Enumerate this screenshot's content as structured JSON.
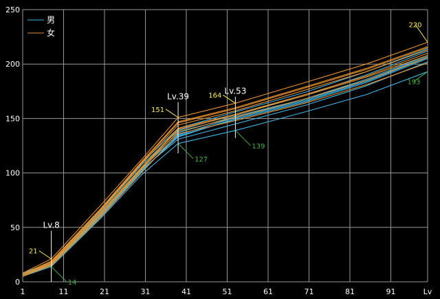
{
  "chart_data": {
    "type": "line",
    "title": "",
    "xlabel": "Lv",
    "ylabel": "",
    "xlim": [
      1,
      100
    ],
    "ylim": [
      0,
      250
    ],
    "x_ticks": [
      1,
      11,
      21,
      31,
      41,
      51,
      61,
      71,
      81,
      91
    ],
    "y_ticks": [
      0,
      50,
      100,
      150,
      200,
      250
    ],
    "grid": true,
    "background": "#000000",
    "legend": {
      "position": "top-left",
      "entries": [
        {
          "label": "男",
          "color": "#3fb6e8"
        },
        {
          "label": "女",
          "color": "#e8922a"
        }
      ]
    },
    "series": [
      {
        "group": "男",
        "color": "#3fb6e8",
        "points": [
          [
            1,
            7
          ],
          [
            8,
            16
          ],
          [
            20,
            62
          ],
          [
            30,
            105
          ],
          [
            39,
            137
          ],
          [
            53,
            152
          ],
          [
            70,
            168
          ],
          [
            85,
            186
          ],
          [
            100,
            208
          ]
        ]
      },
      {
        "group": "男",
        "color": "#3fb6e8",
        "points": [
          [
            1,
            6
          ],
          [
            8,
            15
          ],
          [
            20,
            60
          ],
          [
            30,
            102
          ],
          [
            39,
            133
          ],
          [
            53,
            150
          ],
          [
            70,
            166
          ],
          [
            85,
            184
          ],
          [
            100,
            206
          ]
        ]
      },
      {
        "group": "男",
        "color": "#3fb6e8",
        "points": [
          [
            1,
            5
          ],
          [
            8,
            14
          ],
          [
            20,
            58
          ],
          [
            30,
            98
          ],
          [
            39,
            127
          ],
          [
            53,
            139
          ],
          [
            70,
            156
          ],
          [
            85,
            172
          ],
          [
            100,
            193
          ]
        ]
      },
      {
        "group": "男",
        "color": "#3fb6e8",
        "points": [
          [
            1,
            6
          ],
          [
            8,
            15
          ],
          [
            20,
            61
          ],
          [
            30,
            103
          ],
          [
            39,
            131
          ],
          [
            53,
            145
          ],
          [
            70,
            162
          ],
          [
            85,
            180
          ],
          [
            100,
            202
          ]
        ]
      },
      {
        "group": "男",
        "color": "#3fb6e8",
        "points": [
          [
            1,
            7
          ],
          [
            8,
            17
          ],
          [
            20,
            64
          ],
          [
            30,
            107
          ],
          [
            39,
            139
          ],
          [
            53,
            154
          ],
          [
            70,
            171
          ],
          [
            85,
            190
          ],
          [
            100,
            212
          ]
        ]
      },
      {
        "group": "男",
        "color": "#3fb6e8",
        "points": [
          [
            1,
            8
          ],
          [
            8,
            18
          ],
          [
            20,
            66
          ],
          [
            30,
            109
          ],
          [
            39,
            141
          ],
          [
            53,
            156
          ],
          [
            70,
            174
          ],
          [
            85,
            193
          ],
          [
            100,
            214
          ]
        ]
      },
      {
        "group": "男",
        "color": "#3fb6e8",
        "points": [
          [
            1,
            6
          ],
          [
            8,
            16
          ],
          [
            20,
            63
          ],
          [
            30,
            104
          ],
          [
            39,
            135
          ],
          [
            53,
            151
          ],
          [
            70,
            167
          ],
          [
            85,
            185
          ],
          [
            100,
            207
          ]
        ]
      },
      {
        "group": "男",
        "color": "#3fb6e8",
        "points": [
          [
            1,
            7
          ],
          [
            8,
            15
          ],
          [
            20,
            60
          ],
          [
            30,
            101
          ],
          [
            39,
            134
          ],
          [
            53,
            149
          ],
          [
            70,
            165
          ],
          [
            85,
            183
          ],
          [
            100,
            205
          ]
        ]
      },
      {
        "group": "女",
        "color": "#e8922a",
        "points": [
          [
            1,
            8
          ],
          [
            8,
            21
          ],
          [
            20,
            70
          ],
          [
            30,
            112
          ],
          [
            39,
            151
          ],
          [
            53,
            164
          ],
          [
            70,
            183
          ],
          [
            85,
            200
          ],
          [
            100,
            220
          ]
        ]
      },
      {
        "group": "女",
        "color": "#e8922a",
        "points": [
          [
            1,
            7
          ],
          [
            8,
            19
          ],
          [
            20,
            67
          ],
          [
            30,
            110
          ],
          [
            39,
            147
          ],
          [
            53,
            160
          ],
          [
            70,
            179
          ],
          [
            85,
            196
          ],
          [
            100,
            216
          ]
        ]
      },
      {
        "group": "女",
        "color": "#e8922a",
        "points": [
          [
            1,
            7
          ],
          [
            8,
            18
          ],
          [
            20,
            65
          ],
          [
            30,
            108
          ],
          [
            39,
            144
          ],
          [
            53,
            157
          ],
          [
            70,
            176
          ],
          [
            85,
            193
          ],
          [
            100,
            213
          ]
        ]
      },
      {
        "group": "女",
        "color": "#e8922a",
        "points": [
          [
            1,
            6
          ],
          [
            8,
            17
          ],
          [
            20,
            63
          ],
          [
            30,
            105
          ],
          [
            39,
            141
          ],
          [
            53,
            154
          ],
          [
            70,
            172
          ],
          [
            85,
            189
          ],
          [
            100,
            210
          ]
        ]
      },
      {
        "group": "女",
        "color": "#e8922a",
        "points": [
          [
            1,
            6
          ],
          [
            8,
            16
          ],
          [
            20,
            61
          ],
          [
            30,
            103
          ],
          [
            39,
            138
          ],
          [
            53,
            151
          ],
          [
            70,
            168
          ],
          [
            85,
            185
          ],
          [
            100,
            206
          ]
        ]
      },
      {
        "group": "女",
        "color": "#e8922a",
        "points": [
          [
            1,
            5
          ],
          [
            8,
            15
          ],
          [
            20,
            59
          ],
          [
            30,
            100
          ],
          [
            39,
            136
          ],
          [
            53,
            148
          ],
          [
            70,
            164
          ],
          [
            85,
            181
          ],
          [
            100,
            201
          ]
        ]
      },
      {
        "group": "女",
        "color": "#e8922a",
        "points": [
          [
            1,
            7
          ],
          [
            8,
            18
          ],
          [
            20,
            66
          ],
          [
            30,
            109
          ],
          [
            39,
            146
          ],
          [
            53,
            159
          ],
          [
            70,
            178
          ],
          [
            85,
            195
          ],
          [
            100,
            215
          ]
        ]
      },
      {
        "group": "女",
        "color": "#e8922a",
        "points": [
          [
            1,
            6
          ],
          [
            8,
            17
          ],
          [
            20,
            62
          ],
          [
            30,
            104
          ],
          [
            39,
            140
          ],
          [
            53,
            153
          ],
          [
            70,
            171
          ],
          [
            85,
            188
          ],
          [
            100,
            208
          ]
        ]
      }
    ],
    "markers": [
      {
        "x": 8,
        "label": "Lv.8",
        "y_top": 47,
        "y_bottom": 0
      },
      {
        "x": 39,
        "label": "Lv.39",
        "y_top": 165,
        "y_bottom": 118
      },
      {
        "x": 53,
        "label": "Lv.53",
        "y_top": 170,
        "y_bottom": 132
      }
    ],
    "annotations": [
      {
        "text": "21",
        "x": 8,
        "y": 21,
        "kind": "max"
      },
      {
        "text": "14",
        "x": 8,
        "y": 14,
        "kind": "min"
      },
      {
        "text": "151",
        "x": 39,
        "y": 151,
        "kind": "max"
      },
      {
        "text": "127",
        "x": 39,
        "y": 127,
        "kind": "min"
      },
      {
        "text": "164",
        "x": 53,
        "y": 164,
        "kind": "max"
      },
      {
        "text": "139",
        "x": 53,
        "y": 139,
        "kind": "min"
      },
      {
        "text": "220",
        "x": 100,
        "y": 220,
        "kind": "max"
      },
      {
        "text": "193",
        "x": 100,
        "y": 193,
        "kind": "min"
      }
    ],
    "annotation_colors": {
      "max": "#ffee44",
      "min": "#3cb43c"
    }
  }
}
